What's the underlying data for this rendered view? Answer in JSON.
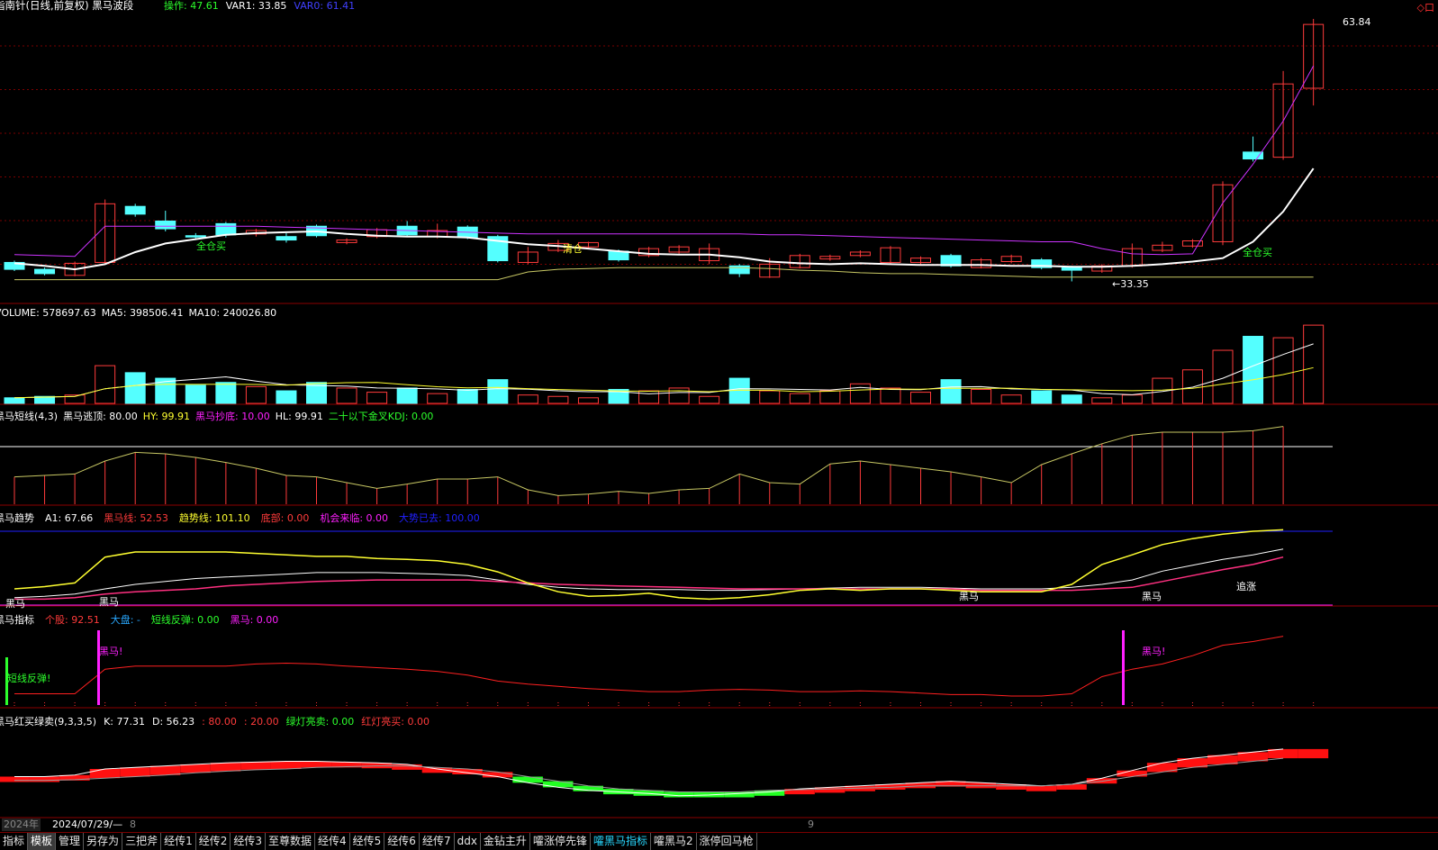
{
  "colors": {
    "up": "#ff3b3b",
    "down": "#54ffff",
    "ma_white": "#ffffff",
    "ma_purple": "#cc33ff",
    "ma_yellow": "#c8c864",
    "green": "#2cff2c",
    "magenta": "#ff20ff",
    "yellow": "#ffff30",
    "divider": "#8b0000",
    "blue_line": "#2020ff"
  },
  "top_icons": "◇口",
  "panels": {
    "main": {
      "title": "指南针(日线,前复权) 黑马波段",
      "indicators": [
        {
          "label": "操作: 47.61",
          "color": "#2cff2c"
        },
        {
          "label": "VAR1: 33.85",
          "color": "#ffffff"
        },
        {
          "label": "VAR0: 61.41",
          "color": "#4040ff"
        }
      ],
      "high_label": "63.84",
      "low_label": "←33.35",
      "annotations": [
        {
          "text": "全仓买",
          "color": "#2cff2c"
        },
        {
          "text": "清仓",
          "color": "#ffff30"
        },
        {
          "text": "全仓买",
          "color": "#2cff2c"
        }
      ]
    },
    "volume": {
      "indicators": [
        {
          "label": "VOLUME: 578697.63",
          "color": "#ffffff"
        },
        {
          "label": "MA5: 398506.41",
          "color": "#ffffff"
        },
        {
          "label": "MA10: 240026.80",
          "color": "#ffffff"
        }
      ]
    },
    "short": {
      "indicators": [
        {
          "label": "黑马短线(4,3)",
          "color": "#ffffff"
        },
        {
          "label": "黑马逃顶: 80.00",
          "color": "#ffffff"
        },
        {
          "label": "HY: 99.91",
          "color": "#ffff30"
        },
        {
          "label": "黑马抄底: 10.00",
          "color": "#ff20ff"
        },
        {
          "label": "HL: 99.91",
          "color": "#ffffff"
        },
        {
          "label": "二十以下金叉KDJ: 0.00",
          "color": "#2cff2c"
        }
      ]
    },
    "trend": {
      "indicators": [
        {
          "label": "黑马趋势",
          "color": "#ffffff"
        },
        {
          "label": "A1: 67.66",
          "color": "#ffffff"
        },
        {
          "label": "黑马线: 52.53",
          "color": "#ff3b3b"
        },
        {
          "label": "趋势线: 101.10",
          "color": "#ffff30"
        },
        {
          "label": "底部: 0.00",
          "color": "#ff3b3b"
        },
        {
          "label": "机会来临: 0.00",
          "color": "#ff20ff"
        },
        {
          "label": "大势已去: 100.00",
          "color": "#2020ff"
        }
      ],
      "labels": [
        "黑马",
        "黑马",
        "黑马",
        "黑马",
        "追涨"
      ]
    },
    "index": {
      "indicators": [
        {
          "label": "黑马指标",
          "color": "#ffffff"
        },
        {
          "label": "个股: 92.51",
          "color": "#ff3b3b"
        },
        {
          "label": "大盘: -",
          "color": "#29a8ff"
        },
        {
          "label": "短线反弹: 0.00",
          "color": "#2cff2c"
        },
        {
          "label": "黑马: 0.00",
          "color": "#ff20ff"
        }
      ],
      "labels": [
        "短线反弹!",
        "黑马!",
        "黑马!"
      ]
    },
    "kdj": {
      "indicators": [
        {
          "label": "黑马红买绿卖(9,3,3,5)",
          "color": "#ffffff"
        },
        {
          "label": "K: 77.31",
          "color": "#ffffff"
        },
        {
          "label": "D: 56.23",
          "color": "#ffffff"
        },
        {
          "label": ": 80.00",
          "color": "#ff3b3b"
        },
        {
          "label": ": 20.00",
          "color": "#ff3b3b"
        },
        {
          "label": "绿灯亮卖: 0.00",
          "color": "#2cff2c"
        },
        {
          "label": "红灯亮买: 0.00",
          "color": "#ff3b3b"
        }
      ]
    }
  },
  "timebar": {
    "year": "2024年",
    "date": "2024/07/29/—",
    "month1": "8",
    "month2": "9"
  },
  "tabs": [
    {
      "label": "指标"
    },
    {
      "label": "模板"
    },
    {
      "label": "管理"
    },
    {
      "label": "另存为"
    },
    {
      "label": "三把斧"
    },
    {
      "label": "经传1"
    },
    {
      "label": "经传2"
    },
    {
      "label": "经传3"
    },
    {
      "label": "至尊数据"
    },
    {
      "label": "经传4"
    },
    {
      "label": "经传5"
    },
    {
      "label": "经传6"
    },
    {
      "label": "经传7"
    },
    {
      "label": "ddx"
    },
    {
      "label": "金钻主升"
    },
    {
      "label": "嚯涨停先锋"
    },
    {
      "label": "嚯黑马指标"
    },
    {
      "label": "嚯黑马2"
    },
    {
      "label": "涨停回马枪"
    }
  ],
  "active_tab": 1,
  "highlight_tab": 16,
  "chart_data": {
    "type": "candlestick",
    "candles": [
      {
        "o": 35.6,
        "c": 34.8,
        "h": 35.8,
        "l": 34.6
      },
      {
        "o": 34.8,
        "c": 34.3,
        "h": 35.0,
        "l": 34.1
      },
      {
        "o": 34.1,
        "c": 35.5,
        "h": 35.7,
        "l": 34.0
      },
      {
        "o": 35.6,
        "c": 42.4,
        "h": 42.9,
        "l": 35.4
      },
      {
        "o": 42.1,
        "c": 41.2,
        "h": 42.4,
        "l": 40.9
      },
      {
        "o": 40.4,
        "c": 39.5,
        "h": 41.6,
        "l": 39.2
      },
      {
        "o": 38.7,
        "c": 38.6,
        "h": 39.0,
        "l": 38.2
      },
      {
        "o": 40.1,
        "c": 38.8,
        "h": 40.3,
        "l": 38.5
      },
      {
        "o": 38.9,
        "c": 39.3,
        "h": 39.5,
        "l": 38.6
      },
      {
        "o": 38.6,
        "c": 38.2,
        "h": 39.0,
        "l": 37.9
      },
      {
        "o": 39.8,
        "c": 38.7,
        "h": 40.0,
        "l": 38.5
      },
      {
        "o": 37.9,
        "c": 38.2,
        "h": 38.4,
        "l": 37.7
      },
      {
        "o": 38.6,
        "c": 39.4,
        "h": 39.6,
        "l": 38.4
      },
      {
        "o": 39.8,
        "c": 38.8,
        "h": 40.4,
        "l": 38.6
      },
      {
        "o": 38.6,
        "c": 39.3,
        "h": 40.1,
        "l": 38.4
      },
      {
        "o": 39.7,
        "c": 38.5,
        "h": 39.9,
        "l": 38.3
      },
      {
        "o": 38.6,
        "c": 35.8,
        "h": 38.8,
        "l": 35.6
      },
      {
        "o": 35.6,
        "c": 36.8,
        "h": 37.4,
        "l": 35.4
      },
      {
        "o": 37.0,
        "c": 37.8,
        "h": 38.2,
        "l": 36.8
      },
      {
        "o": 37.4,
        "c": 37.9,
        "h": 38.0,
        "l": 37.2
      },
      {
        "o": 36.9,
        "c": 35.9,
        "h": 37.1,
        "l": 35.7
      },
      {
        "o": 36.4,
        "c": 37.2,
        "h": 37.4,
        "l": 36.2
      },
      {
        "o": 36.8,
        "c": 37.4,
        "h": 37.6,
        "l": 36.6
      },
      {
        "o": 35.8,
        "c": 37.2,
        "h": 37.8,
        "l": 35.4
      },
      {
        "o": 35.2,
        "c": 34.3,
        "h": 35.4,
        "l": 33.9
      },
      {
        "o": 33.9,
        "c": 35.4,
        "h": 36.1,
        "l": 33.8
      },
      {
        "o": 35.0,
        "c": 36.4,
        "h": 36.6,
        "l": 34.9
      },
      {
        "o": 36.0,
        "c": 36.3,
        "h": 36.5,
        "l": 35.8
      },
      {
        "o": 36.4,
        "c": 36.8,
        "h": 37.0,
        "l": 36.2
      },
      {
        "o": 35.6,
        "c": 37.3,
        "h": 37.5,
        "l": 35.4
      },
      {
        "o": 35.6,
        "c": 36.1,
        "h": 36.3,
        "l": 35.4
      },
      {
        "o": 36.4,
        "c": 35.2,
        "h": 36.6,
        "l": 35.0
      },
      {
        "o": 35.0,
        "c": 35.9,
        "h": 36.1,
        "l": 34.9
      },
      {
        "o": 35.7,
        "c": 36.3,
        "h": 36.5,
        "l": 35.5
      },
      {
        "o": 35.9,
        "c": 35.0,
        "h": 36.1,
        "l": 34.8
      },
      {
        "o": 35.0,
        "c": 34.7,
        "h": 35.2,
        "l": 33.4
      },
      {
        "o": 34.6,
        "c": 35.2,
        "h": 35.4,
        "l": 34.4
      },
      {
        "o": 35.2,
        "c": 37.2,
        "h": 37.8,
        "l": 35.0
      },
      {
        "o": 37.0,
        "c": 37.6,
        "h": 38.0,
        "l": 36.8
      },
      {
        "o": 37.5,
        "c": 38.1,
        "h": 38.3,
        "l": 37.3
      },
      {
        "o": 38.0,
        "c": 44.6,
        "h": 45.0,
        "l": 37.6
      },
      {
        "o": 48.4,
        "c": 47.6,
        "h": 50.2,
        "l": 47.3
      },
      {
        "o": 47.8,
        "c": 56.3,
        "h": 57.8,
        "l": 47.5
      },
      {
        "o": 55.8,
        "c": 63.2,
        "h": 63.84,
        "l": 53.8
      }
    ],
    "ma_white": [
      35.5,
      35.2,
      34.8,
      35.4,
      36.8,
      37.8,
      38.3,
      38.8,
      39.0,
      39.1,
      39.2,
      38.9,
      38.7,
      38.6,
      38.6,
      38.5,
      38.1,
      37.7,
      37.5,
      37.2,
      36.9,
      36.6,
      36.5,
      36.5,
      36.2,
      35.7,
      35.5,
      35.4,
      35.5,
      35.4,
      35.3,
      35.3,
      35.3,
      35.2,
      35.2,
      35.1,
      35.1,
      35.2,
      35.4,
      35.7,
      36.1,
      38.0,
      41.5,
      46.5
    ],
    "ma_purple": [
      36.5,
      36.4,
      36.3,
      39.8,
      39.8,
      39.8,
      39.8,
      39.8,
      39.8,
      39.7,
      39.6,
      39.5,
      39.4,
      39.3,
      39.2,
      39.1,
      39.0,
      38.9,
      38.9,
      38.9,
      38.9,
      38.9,
      38.9,
      38.9,
      38.9,
      38.8,
      38.8,
      38.7,
      38.6,
      38.5,
      38.4,
      38.3,
      38.2,
      38.1,
      38.0,
      38.0,
      37.2,
      36.6,
      36.5,
      36.6,
      42.5,
      47.0,
      52.0,
      58.4
    ],
    "ma_yellow": [
      33.6,
      33.6,
      33.6,
      33.6,
      33.6,
      33.6,
      33.6,
      33.6,
      33.6,
      33.6,
      33.6,
      33.6,
      33.6,
      33.6,
      33.6,
      33.6,
      33.6,
      34.5,
      34.8,
      34.9,
      35.0,
      35.0,
      35.0,
      35.0,
      35.0,
      34.9,
      34.7,
      34.6,
      34.4,
      34.3,
      34.3,
      34.2,
      34.1,
      34.0,
      33.9,
      33.9,
      33.9,
      33.9,
      33.9,
      33.9,
      33.9,
      33.9,
      33.9,
      33.9
    ],
    "volume": [
      40,
      50,
      60,
      270,
      220,
      180,
      130,
      150,
      120,
      90,
      150,
      110,
      80,
      110,
      70,
      100,
      170,
      60,
      50,
      40,
      100,
      90,
      110,
      50,
      180,
      90,
      70,
      90,
      140,
      110,
      80,
      170,
      100,
      60,
      90,
      60,
      40,
      60,
      180,
      240,
      380,
      480,
      470,
      560
    ]
  }
}
